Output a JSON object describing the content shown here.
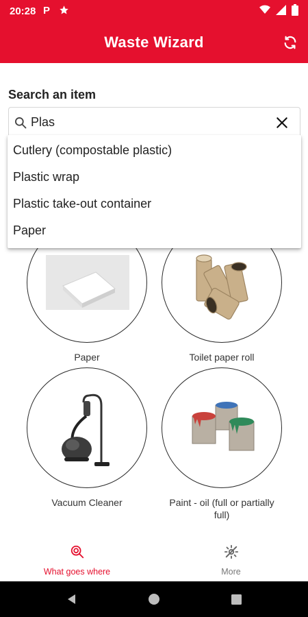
{
  "status_bar": {
    "time": "20:28",
    "icons": [
      "parking-icon",
      "star-icon"
    ],
    "right_icons": [
      "wifi-icon",
      "signal-icon",
      "battery-icon"
    ]
  },
  "app_bar": {
    "title": "Waste Wizard",
    "action_icon": "refresh-icon"
  },
  "search": {
    "label": "Search an item",
    "value": "Plas",
    "icon": "search-icon",
    "clear_icon": "close-icon",
    "suggestions": [
      "Cutlery (compostable plastic)",
      "Plastic wrap",
      "Plastic take-out container",
      "Paper"
    ]
  },
  "items": [
    {
      "label": "Paper",
      "icon": "paper-stack-icon"
    },
    {
      "label": "Toilet paper roll",
      "icon": "toilet-paper-roll-icon"
    },
    {
      "label": "Vacuum Cleaner",
      "icon": "vacuum-cleaner-icon"
    },
    {
      "label": "Paint - oil (full or partially full)",
      "icon": "paint-cans-icon"
    }
  ],
  "bottom_nav": [
    {
      "label": "What goes where",
      "icon": "search-target-icon",
      "active": true
    },
    {
      "label": "More",
      "icon": "gear-icon",
      "active": false
    }
  ],
  "colors": {
    "brand": "#e5102e",
    "text": "#222222",
    "inactive": "#777777"
  }
}
